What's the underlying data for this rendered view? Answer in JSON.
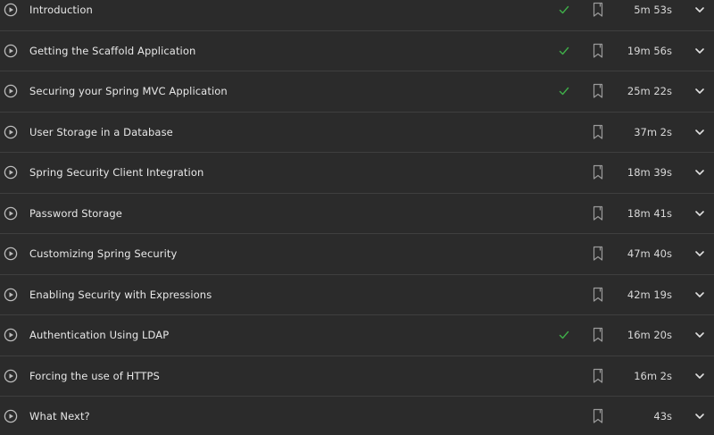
{
  "modules": [
    {
      "title": "Introduction",
      "completed": true,
      "duration": "5m 53s"
    },
    {
      "title": "Getting the Scaffold Application",
      "completed": true,
      "duration": "19m 56s"
    },
    {
      "title": "Securing your Spring MVC Application",
      "completed": true,
      "duration": "25m 22s"
    },
    {
      "title": "User Storage in a Database",
      "completed": false,
      "duration": "37m 2s"
    },
    {
      "title": "Spring Security Client Integration",
      "completed": false,
      "duration": "18m 39s"
    },
    {
      "title": "Password Storage",
      "completed": false,
      "duration": "18m 41s"
    },
    {
      "title": "Customizing Spring Security",
      "completed": false,
      "duration": "47m 40s"
    },
    {
      "title": "Enabling Security with Expressions",
      "completed": false,
      "duration": "42m 19s"
    },
    {
      "title": "Authentication Using LDAP",
      "completed": true,
      "duration": "16m 20s"
    },
    {
      "title": "Forcing the use of HTTPS",
      "completed": false,
      "duration": "16m 2s"
    },
    {
      "title": "What Next?",
      "completed": false,
      "duration": "43s"
    }
  ],
  "icons": {
    "play": "play-circle-icon",
    "check": "checkmark-icon",
    "bookmark": "bookmark-icon",
    "expand": "chevron-down-icon"
  },
  "colors": {
    "background": "#2b2b2b",
    "divider": "#3f3f3f",
    "text": "#e8e8e8",
    "check": "#3fae49",
    "icon": "#9a9a9a"
  }
}
